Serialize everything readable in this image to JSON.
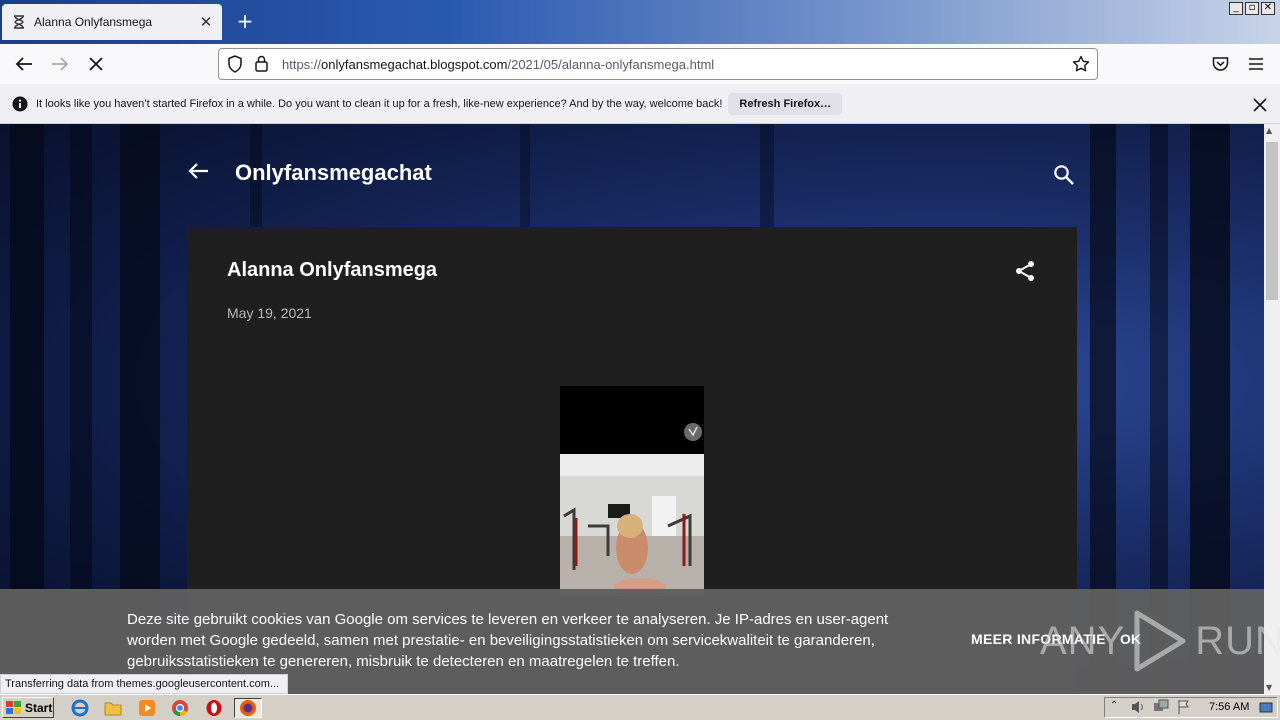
{
  "browser": {
    "tab": {
      "title": "Alanna Onlyfansmega",
      "close_glyph": "✕",
      "favicon": "hourglass-icon"
    },
    "new_tab_glyph": "+",
    "window_controls": [
      "_",
      "▫",
      "✕"
    ],
    "url": {
      "prefix": "https://",
      "host": "onlyfansmegachat.blogspot.com",
      "path": "/2021/05/alanna-onlyfansmega.html"
    },
    "notification": {
      "text": "It looks like you haven’t started Firefox in a while. Do you want to clean it up for a fresh, like-new experience? And by the way, welcome back!",
      "button": "Refresh Firefox…"
    },
    "status": "Transferring data from themes.googleusercontent.com..."
  },
  "blog": {
    "title": "Onlyfansmegachat",
    "post": {
      "title": "Alanna Onlyfansmega",
      "date": "May 19, 2021"
    }
  },
  "cookie": {
    "text": "Deze site gebruikt cookies van Google om services te leveren en verkeer te analyseren. Je IP-adres en user-agent worden met Google gedeeld, samen met prestatie- en beveiligingsstatistieken om servicekwaliteit te garanderen, gebruiksstatistieken te genereren, misbruik te detecteren en maatregelen te treffen.",
    "more": "MEER INFORMATIE",
    "ok": "OK"
  },
  "watermark": {
    "left": "ANY",
    "right": "RUN"
  },
  "taskbar": {
    "start": "Start",
    "clock": "7:56 AM"
  },
  "colors": {
    "page_bg": "#1b2f6b",
    "post_bg": "#1f1f1f",
    "cookie_bg": "#5f5f5f",
    "taskbar": "#d4d0c8"
  }
}
